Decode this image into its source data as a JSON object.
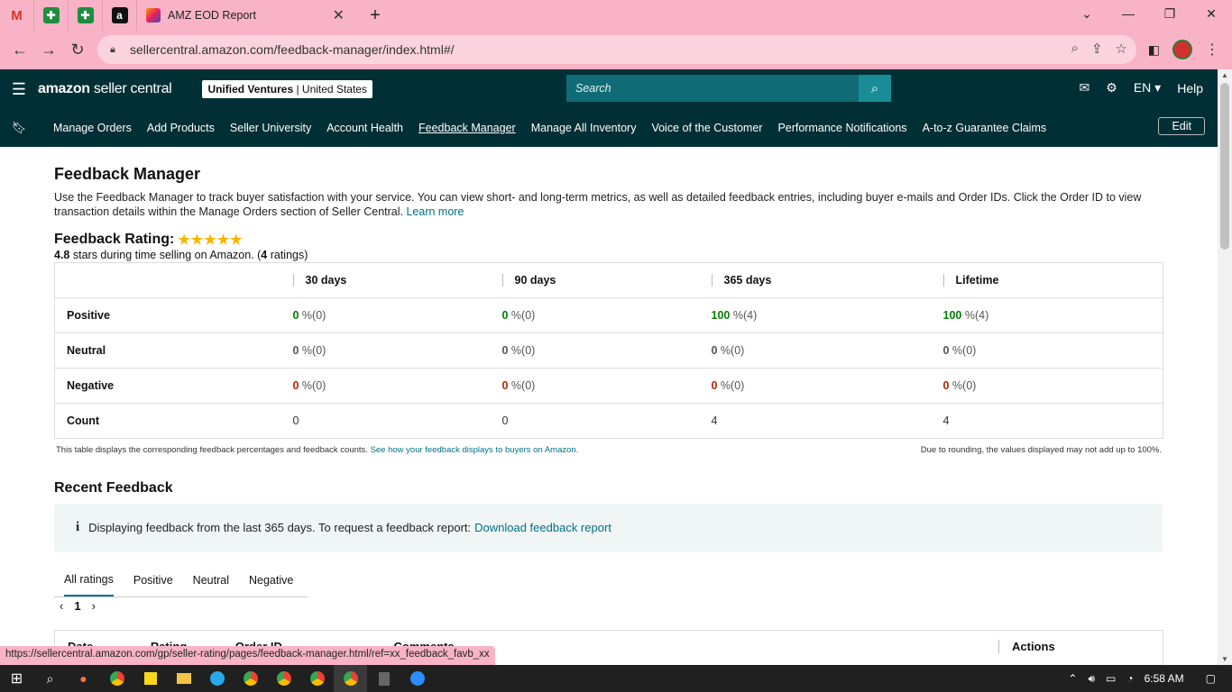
{
  "browser": {
    "active_tab_title": "AMZ EOD Report",
    "url": "sellercentral.amazon.com/feedback-manager/index.html#/",
    "status_url": "https://sellercentral.amazon.com/gp/seller-rating/pages/feedback-manager.html/ref=xx_feedback_favb_xx",
    "pinned_icons": [
      "gmail-icon",
      "sheets-icon",
      "sheets-icon",
      "amazon-icon"
    ]
  },
  "header": {
    "logo_brand": "amazon",
    "logo_text": " seller central",
    "account_name": "Unified Ventures",
    "account_sep": " | ",
    "account_region": "United States",
    "search_placeholder": "Search",
    "language": "EN",
    "help": "Help"
  },
  "nav": {
    "items": [
      "Manage Orders",
      "Add Products",
      "Seller University",
      "Account Health",
      "Feedback Manager",
      "Manage All Inventory",
      "Voice of the Customer",
      "Performance Notifications",
      "A-to-z Guarantee Claims"
    ],
    "edit": "Edit"
  },
  "page": {
    "title": "Feedback Manager",
    "intro": "Use the Feedback Manager to track buyer satisfaction with your service. You can view short- and long-term metrics, as well as detailed feedback entries, including buyer e-mails and Order IDs. Click the Order ID to view transaction details within the Manage Orders section of Seller Central. ",
    "learn_more": "Learn more",
    "rating_label": "Feedback Rating:",
    "rating_stars": "★★★★★",
    "rating_value": "4.8",
    "rating_sub_1": " stars during time selling on Amazon. (",
    "rating_count": "4",
    "rating_sub_2": " ratings)"
  },
  "table": {
    "columns": [
      "30 days",
      "90 days",
      "365 days",
      "Lifetime"
    ],
    "rows": [
      {
        "label": "Positive",
        "cells": [
          {
            "v": "0",
            "c": "(0)"
          },
          {
            "v": "0",
            "c": "(0)"
          },
          {
            "v": "100",
            "c": "(4)"
          },
          {
            "v": "100",
            "c": "(4)"
          }
        ]
      },
      {
        "label": "Neutral",
        "cells": [
          {
            "v": "0",
            "c": "(0)"
          },
          {
            "v": "0",
            "c": "(0)"
          },
          {
            "v": "0",
            "c": "(0)"
          },
          {
            "v": "0",
            "c": "(0)"
          }
        ]
      },
      {
        "label": "Negative",
        "cells": [
          {
            "v": "0",
            "c": "(0)"
          },
          {
            "v": "0",
            "c": "(0)"
          },
          {
            "v": "0",
            "c": "(0)"
          },
          {
            "v": "0",
            "c": "(0)"
          }
        ]
      }
    ],
    "count_label": "Count",
    "counts": [
      "0",
      "0",
      "4",
      "4"
    ],
    "pct": " %",
    "footnote": "This table displays the corresponding feedback percentages and feedback counts. ",
    "footnote_link": "See how your feedback displays to buyers on Amazon.",
    "rounding": "Due to rounding, the values displayed may not add up to 100%."
  },
  "recent": {
    "title": "Recent Feedback",
    "info": "Displaying feedback from the last 365 days. To request a feedback report: ",
    "info_link": "Download feedback report",
    "tabs": [
      "All ratings",
      "Positive",
      "Neutral",
      "Negative"
    ],
    "page": "1",
    "list_headers": [
      "Date",
      "Rating",
      "Order ID",
      "Comments"
    ],
    "actions_header": "Actions"
  },
  "taskbar": {
    "time": "6:58 AM"
  },
  "colors": {
    "header_bg": "#002f36",
    "tab_pink": "#f8b4c6",
    "positive": "#067d06",
    "negative": "#b12704",
    "link": "#007185"
  }
}
